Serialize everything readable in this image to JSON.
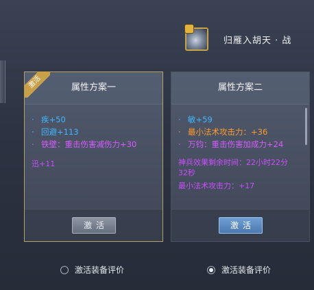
{
  "header": {
    "item_name": "归雁入胡天 · 战",
    "item_icon": "gem-item-icon",
    "lock_icon": "lock-icon"
  },
  "panels": [
    {
      "title": "属性方案一",
      "badge": "激活",
      "active": true,
      "attributes": [
        {
          "bullet": "·",
          "text": "疾+50",
          "color": "#3fb7ff"
        },
        {
          "bullet": "·",
          "text": "回避+113",
          "color": "#3fb7ff"
        },
        {
          "bullet": "·",
          "text": "铁壁：重击伤害减伤力+30",
          "color": "#d65cff"
        }
      ],
      "extra_lines": [
        "迅+11"
      ],
      "button_label": "激活"
    },
    {
      "title": "属性方案二",
      "active": false,
      "attributes": [
        {
          "bullet": "·",
          "text": "敏+59",
          "color": "#3fb7ff"
        },
        {
          "bullet": "·",
          "text": "最小法术攻击力：+36",
          "color": "#ff9a2b"
        },
        {
          "bullet": "·",
          "text": "万钧：重击伤害加成力+24",
          "color": "#d65cff"
        }
      ],
      "extra_lines": [
        "神兵效果剩余时间：22小时22分",
        "32秒",
        "最小法术攻击力：+17"
      ],
      "button_label": "激活"
    }
  ],
  "radios": [
    {
      "label": "激活装备评价",
      "checked": false
    },
    {
      "label": "激活装备评价",
      "checked": true
    }
  ],
  "colors": {
    "blue_attr": "#3fb7ff",
    "orange_attr": "#ff9a2b",
    "purple_attr": "#d65cff",
    "active_border": "#b8a06a"
  }
}
